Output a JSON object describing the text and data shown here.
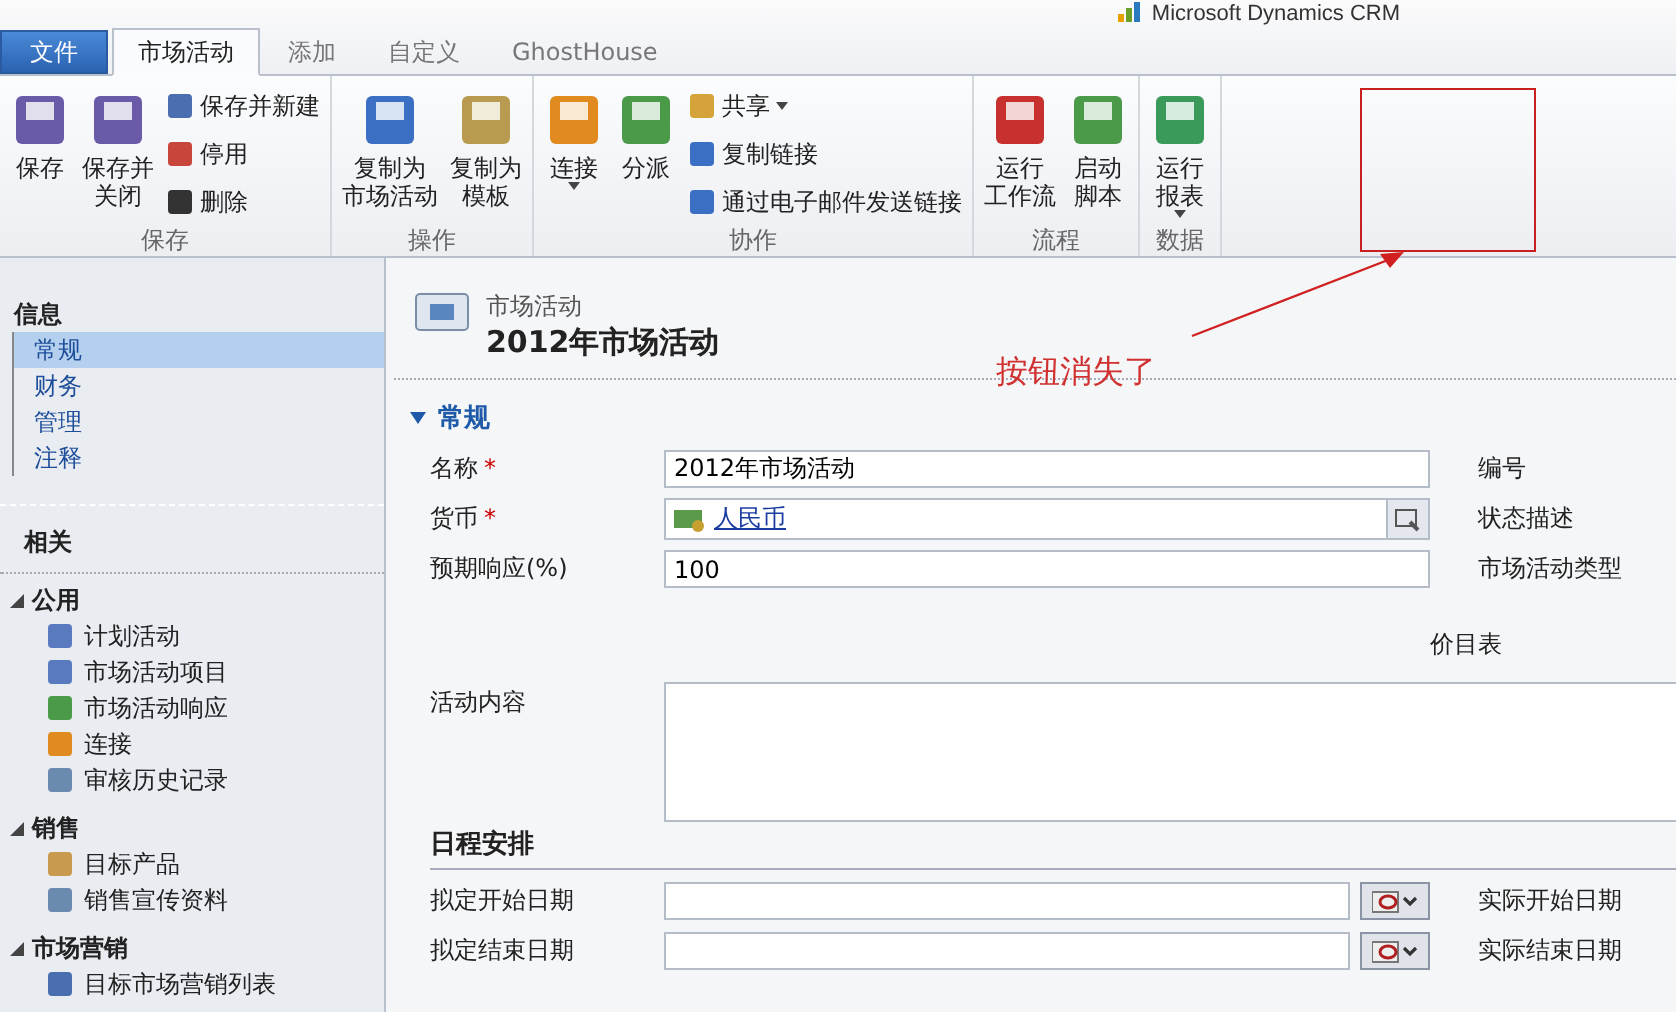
{
  "brand": "Microsoft Dynamics CRM",
  "tabs": [
    {
      "label": "文件",
      "kind": "file",
      "selected": false
    },
    {
      "label": "市场活动",
      "kind": "tab",
      "selected": true
    },
    {
      "label": "添加",
      "kind": "tab",
      "selected": false
    },
    {
      "label": "自定义",
      "kind": "tab",
      "selected": false
    },
    {
      "label": "GhostHouse",
      "kind": "tab",
      "selected": false
    }
  ],
  "ribbon": [
    {
      "label": "保存",
      "large": [
        {
          "lines": [
            "保存"
          ],
          "dropdown": false
        },
        {
          "lines": [
            "保存并",
            "关闭"
          ],
          "dropdown": false
        }
      ],
      "small": [
        {
          "label": "保存并新建",
          "dropdown": false
        },
        {
          "label": "停用",
          "dropdown": false
        },
        {
          "label": "删除",
          "dropdown": false
        }
      ]
    },
    {
      "label": "操作",
      "large": [
        {
          "lines": [
            "复制为",
            "市场活动"
          ],
          "dropdown": false
        },
        {
          "lines": [
            "复制为",
            "模板"
          ],
          "dropdown": false
        }
      ]
    },
    {
      "label": "协作",
      "large": [
        {
          "lines": [
            "连接"
          ],
          "dropdown": true
        },
        {
          "lines": [
            "分派"
          ],
          "dropdown": false
        }
      ],
      "small": [
        {
          "label": "共享",
          "dropdown": true
        },
        {
          "label": "复制链接",
          "dropdown": false
        },
        {
          "label": "通过电子邮件发送链接",
          "dropdown": false
        }
      ]
    },
    {
      "label": "流程",
      "large": [
        {
          "lines": [
            "运行",
            "工作流"
          ],
          "dropdown": false
        },
        {
          "lines": [
            "启动",
            "脚本"
          ],
          "dropdown": false
        }
      ]
    },
    {
      "label": "数据",
      "large": [
        {
          "lines": [
            "运行",
            "报表"
          ],
          "dropdown": true
        }
      ]
    }
  ],
  "annotation": {
    "text": "按钮消失了"
  },
  "sidebar": {
    "info_title": "信息",
    "info_items": [
      {
        "label": "常规",
        "selected": true
      },
      {
        "label": "财务",
        "selected": false
      },
      {
        "label": "管理",
        "selected": false
      },
      {
        "label": "注释",
        "selected": false
      }
    ],
    "related_title": "相关",
    "groups": [
      {
        "label": "公用",
        "expanded": true,
        "items": [
          "计划活动",
          "市场活动项目",
          "市场活动响应",
          "连接",
          "审核历史记录"
        ]
      },
      {
        "label": "销售",
        "expanded": true,
        "items": [
          "目标产品",
          "销售宣传资料"
        ]
      },
      {
        "label": "市场营销",
        "expanded": true,
        "items": [
          "目标市场营销列表"
        ]
      }
    ]
  },
  "form": {
    "entity": "市场活动",
    "title": "2012年市场活动",
    "section": {
      "label": "常规",
      "expanded": true
    },
    "fields": [
      {
        "label": "名称",
        "required_mark": "*",
        "kind": "text",
        "value": "2012年市场活动",
        "right_label": "编号"
      },
      {
        "label": "货币",
        "required_mark": "*",
        "kind": "lookup",
        "value": "人民币",
        "right_label": "状态描述"
      },
      {
        "label": "预期响应(%)",
        "kind": "text",
        "value": "100",
        "right_label": "市场活动类型"
      }
    ],
    "price_list_label": "价目表",
    "content_label": "活动内容",
    "schedule_title": "日程安排",
    "dates": [
      {
        "label": "拟定开始日期",
        "right_label": "实际开始日期"
      },
      {
        "label": "拟定结束日期",
        "right_label": "实际结束日期"
      }
    ]
  }
}
